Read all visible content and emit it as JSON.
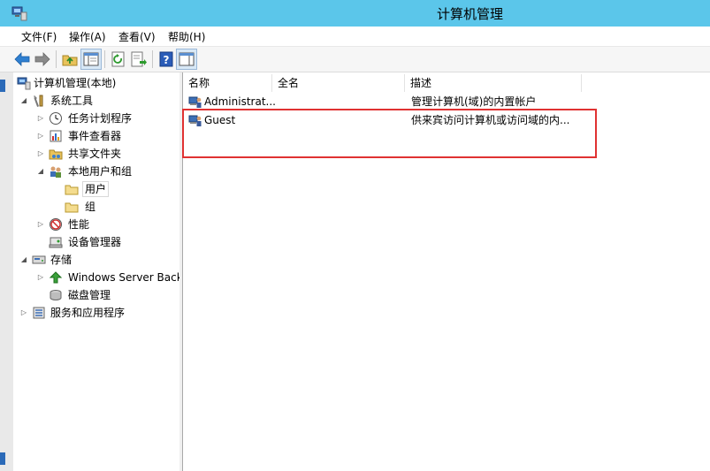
{
  "window": {
    "title": "计算机管理"
  },
  "menu": [
    {
      "label": "文件(F)"
    },
    {
      "label": "操作(A)"
    },
    {
      "label": "查看(V)"
    },
    {
      "label": "帮助(H)"
    }
  ],
  "toolbar": {
    "icons": [
      "back-arrow-icon",
      "forward-arrow-icon",
      "up-folder-icon",
      "show-hide-tree-icon",
      "refresh-icon",
      "export-list-icon",
      "help-icon",
      "show-hide-action-pane-icon"
    ]
  },
  "tree": {
    "root": "计算机管理(本地)",
    "system_tools": "系统工具",
    "task_scheduler": "任务计划程序",
    "event_viewer": "事件查看器",
    "shared_folders": "共享文件夹",
    "local_users_groups": "本地用户和组",
    "users": "用户",
    "groups": "组",
    "performance": "性能",
    "device_manager": "设备管理器",
    "storage": "存储",
    "windows_server_backup": "Windows Server Back",
    "disk_management": "磁盘管理",
    "services_apps": "服务和应用程序"
  },
  "list": {
    "columns": [
      "名称",
      "全名",
      "描述"
    ],
    "rows": [
      {
        "name": "Administrat...",
        "full_name": "",
        "description": "管理计算机(域)的内置帐户"
      },
      {
        "name": "Guest",
        "full_name": "",
        "description": "供来宾访问计算机或访问域的内..."
      }
    ]
  },
  "colors": {
    "titlebar": "#5bc6ea",
    "highlight": "#e03232"
  }
}
